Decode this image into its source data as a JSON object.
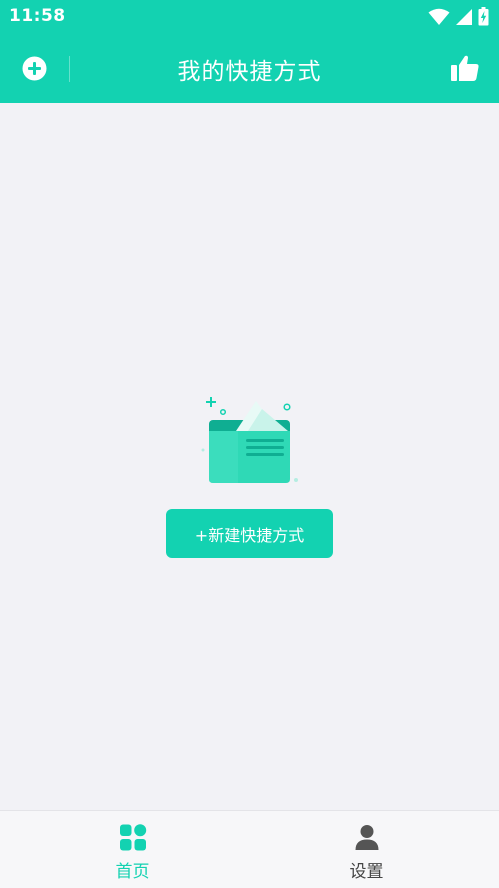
{
  "status_bar": {
    "time": "11:58",
    "icons": [
      "wifi-icon",
      "signal-icon",
      "battery-charging-icon"
    ]
  },
  "app_bar": {
    "title": "我的快捷方式",
    "left_icon": "add-circle-icon",
    "right_icon": "thumbs-up-icon"
  },
  "empty_state": {
    "illustration": "folder-with-documents",
    "button_label": "+新建快捷方式"
  },
  "tab_bar": {
    "tabs": [
      {
        "label": "首页",
        "icon": "grid-icon",
        "active": true
      },
      {
        "label": "设置",
        "icon": "person-icon",
        "active": false
      }
    ]
  },
  "colors": {
    "primary": "#13d2b1",
    "background": "#f2f2f6",
    "tab_inactive": "#444444"
  }
}
